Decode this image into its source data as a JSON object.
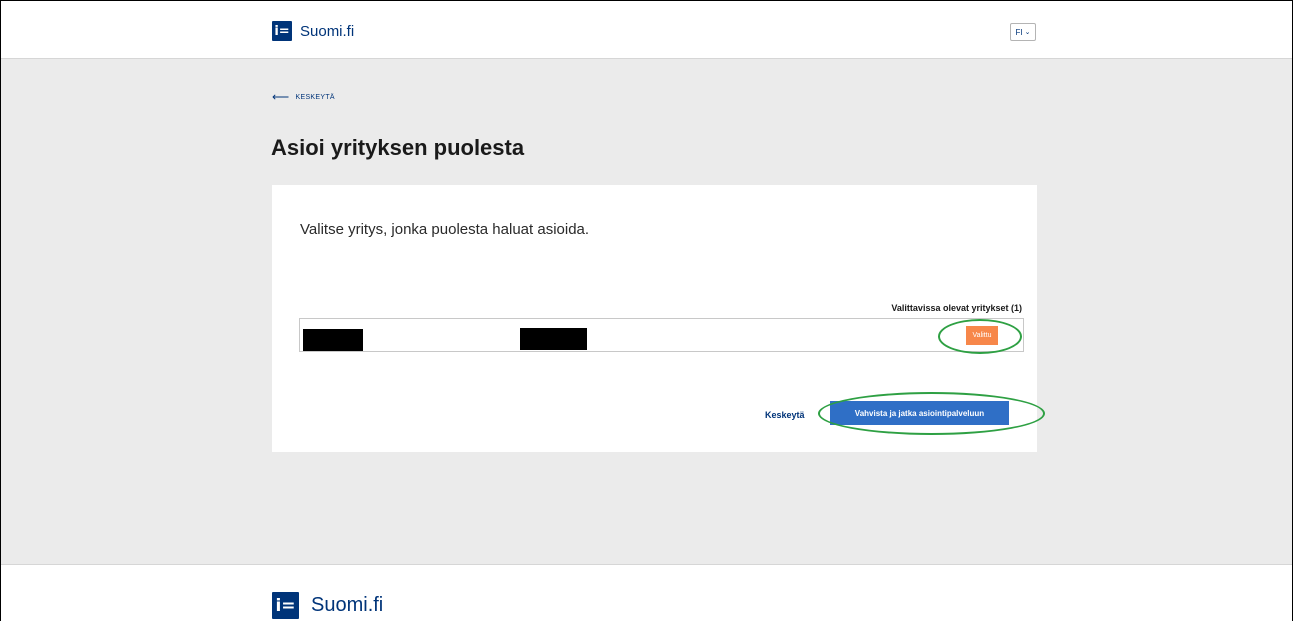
{
  "header": {
    "logo_mark": "i=",
    "logo_text": "Suomi.fi",
    "language": "FI"
  },
  "nav": {
    "back_label": "KESKEYTÄ"
  },
  "page": {
    "title": "Asioi yrityksen puolesta"
  },
  "card": {
    "intro": "Valitse yritys, jonka puolesta haluat asioida.",
    "list_heading": "Valittavissa olevat yritykset (1)",
    "companies": [
      {
        "select_label": "Valittu",
        "status": "selected"
      }
    ],
    "cancel_label": "Keskeytä",
    "confirm_label": "Vahvista ja jatka asiointipalveluun"
  },
  "footer": {
    "logo_mark": "i=",
    "logo_text": "Suomi.fi"
  },
  "colors": {
    "brand": "#003479",
    "selected_button": "#f7874a",
    "primary_button": "#2f6fc6",
    "highlight_ring": "#2ea043"
  }
}
